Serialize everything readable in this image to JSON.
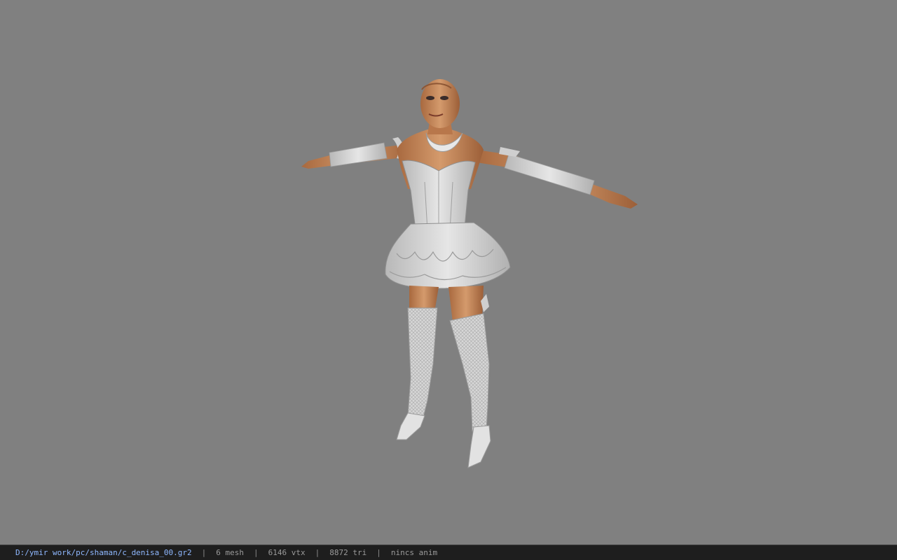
{
  "status_bar": {
    "file_path": "D:/ymir work/pc/shaman/c_denisa_00.gr2",
    "separator": "|",
    "mesh_count": "6 mesh",
    "vertex_count": "6146 vtx",
    "triangle_count": "8872 tri",
    "animation_status": "nincs anim"
  },
  "colors": {
    "viewport_background": "#808080",
    "status_bar_background": "#1e1e1e",
    "path_text": "#8fb8ff",
    "info_text": "#9a9a9a",
    "skin": "#c98b5e",
    "outfit": "#d8d8d8"
  }
}
